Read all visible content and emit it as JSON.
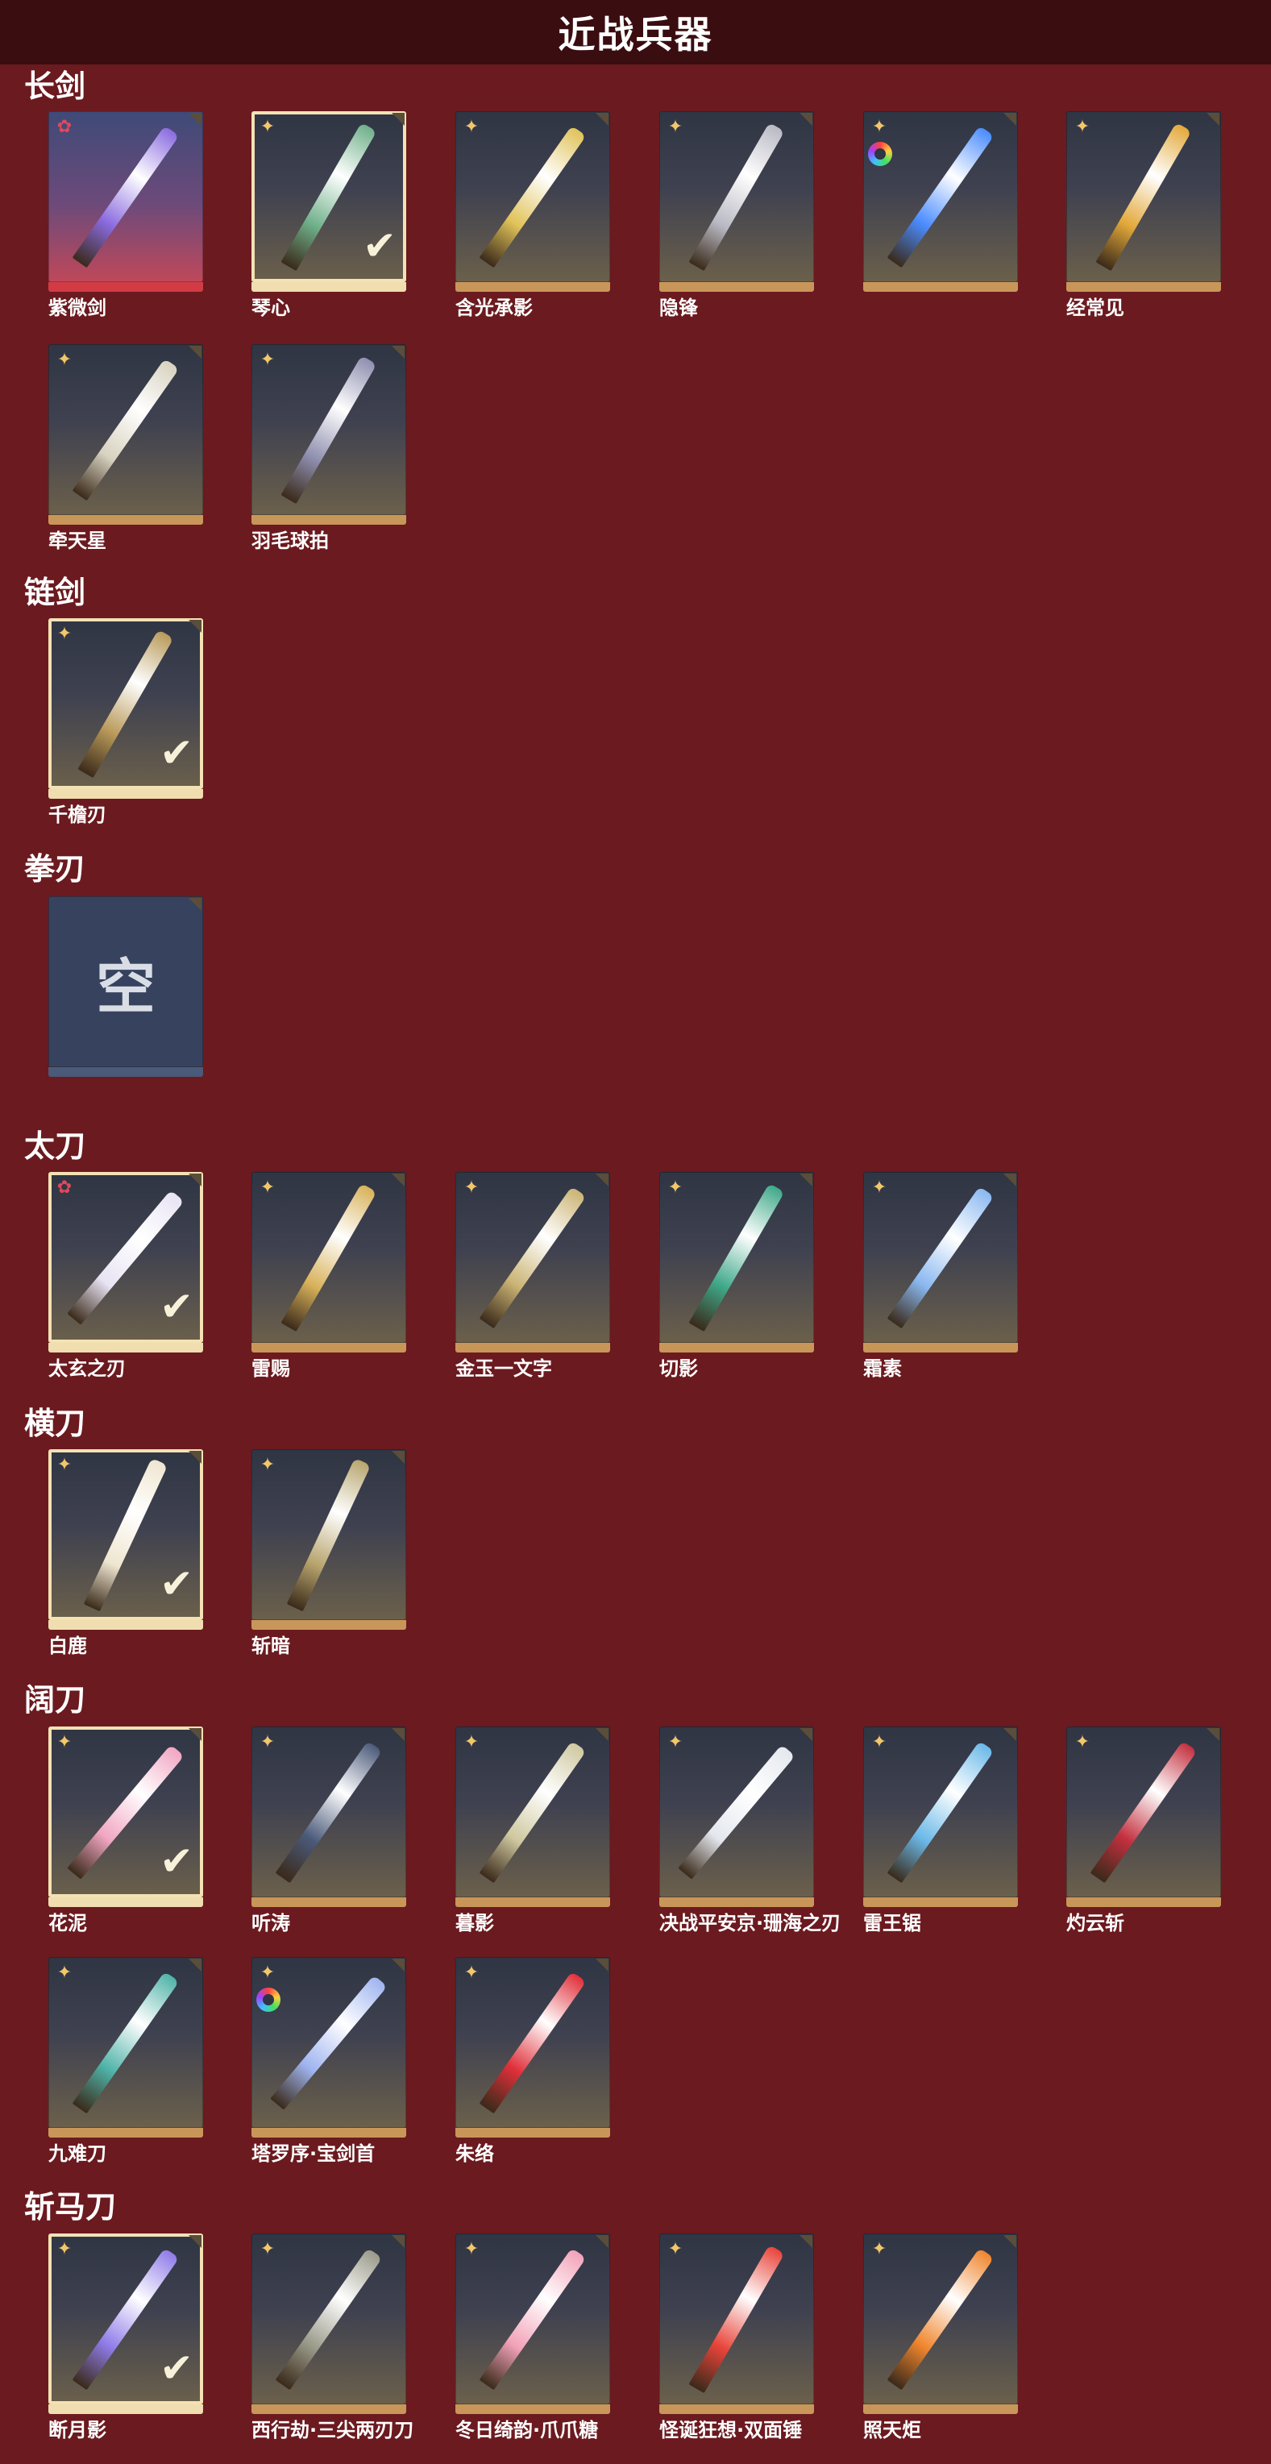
{
  "header": {
    "title": "近战兵器"
  },
  "sections": [
    {
      "id": "long-sword",
      "label": "长剑",
      "items": [
        {
          "name": "紫微剑",
          "rarity": "pink",
          "equipped": false,
          "style": "red",
          "color": "#8a6be0",
          "angle": 35,
          "dyeable": false
        },
        {
          "name": "琴心",
          "rarity": "gold",
          "equipped": true,
          "style": "",
          "color": "#6fb08a",
          "angle": 30,
          "dyeable": false
        },
        {
          "name": "含光承影",
          "rarity": "gold",
          "equipped": false,
          "style": "",
          "color": "#e1c35a",
          "angle": 35,
          "dyeable": false
        },
        {
          "name": "隐锋",
          "rarity": "gold",
          "equipped": false,
          "style": "",
          "color": "#b9b9c4",
          "angle": 30,
          "dyeable": false
        },
        {
          "name": "",
          "rarity": "gold",
          "equipped": false,
          "style": "",
          "color": "#4a8cff",
          "angle": 35,
          "dyeable": true
        },
        {
          "name": "经常见",
          "rarity": "gold",
          "equipped": false,
          "style": "",
          "color": "#e3a93a",
          "angle": 30,
          "dyeable": false
        },
        {
          "name": "牵天星",
          "rarity": "gold",
          "equipped": false,
          "style": "",
          "color": "#d8d2c0",
          "angle": 35,
          "dyeable": false
        },
        {
          "name": "羽毛球拍",
          "rarity": "gold",
          "equipped": false,
          "style": "",
          "color": "#8f8fb0",
          "angle": 30,
          "dyeable": false
        }
      ]
    },
    {
      "id": "chain-sword",
      "label": "链剑",
      "items": [
        {
          "name": "千檐刃",
          "rarity": "gold",
          "equipped": true,
          "style": "",
          "color": "#b99a5a",
          "angle": 30,
          "dyeable": false
        }
      ]
    },
    {
      "id": "fist-blade",
      "label": "拳刃",
      "items": [
        {
          "name": "",
          "rarity": "",
          "equipped": false,
          "style": "empty",
          "color": "",
          "angle": 0,
          "dyeable": false,
          "empty_text": "空"
        }
      ]
    },
    {
      "id": "tachi",
      "label": "太刀",
      "items": [
        {
          "name": "太玄之刃",
          "rarity": "pink",
          "equipped": true,
          "style": "",
          "color": "#e8e4f4",
          "angle": 40,
          "dyeable": false
        },
        {
          "name": "雷赐",
          "rarity": "gold",
          "equipped": false,
          "style": "",
          "color": "#d8b25a",
          "angle": 30,
          "dyeable": false
        },
        {
          "name": "金玉一文字",
          "rarity": "gold",
          "equipped": false,
          "style": "",
          "color": "#cbb474",
          "angle": 35,
          "dyeable": false
        },
        {
          "name": "切影",
          "rarity": "gold",
          "equipped": false,
          "style": "",
          "color": "#3fa889",
          "angle": 30,
          "dyeable": false
        },
        {
          "name": "霜素",
          "rarity": "gold",
          "equipped": false,
          "style": "",
          "color": "#8ab8f0",
          "angle": 35,
          "dyeable": false
        }
      ]
    },
    {
      "id": "horizontal-blade",
      "label": "横刀",
      "items": [
        {
          "name": "白鹿",
          "rarity": "gold",
          "equipped": true,
          "style": "",
          "color": "#efe6d0",
          "angle": 25,
          "dyeable": false
        },
        {
          "name": "斩暗",
          "rarity": "gold",
          "equipped": false,
          "style": "",
          "color": "#b8a56e",
          "angle": 25,
          "dyeable": false
        }
      ]
    },
    {
      "id": "broad-blade",
      "label": "阔刀",
      "items": [
        {
          "name": "花泥",
          "rarity": "gold",
          "equipped": true,
          "style": "",
          "color": "#f1a6c2",
          "angle": 40,
          "dyeable": false
        },
        {
          "name": "听涛",
          "rarity": "gold",
          "equipped": false,
          "style": "",
          "color": "#4b5a7a",
          "angle": 35,
          "dyeable": false
        },
        {
          "name": "暮影",
          "rarity": "gold",
          "equipped": false,
          "style": "",
          "color": "#cfc8a0",
          "angle": 35,
          "dyeable": false
        },
        {
          "name": "决战平安京·珊海之刃",
          "rarity": "gold",
          "equipped": false,
          "style": "",
          "color": "#e4e8ee",
          "angle": 40,
          "dyeable": false
        },
        {
          "name": "雷王锯",
          "rarity": "gold",
          "equipped": false,
          "style": "",
          "color": "#6bb9e8",
          "angle": 35,
          "dyeable": false
        },
        {
          "name": "灼云斩",
          "rarity": "gold",
          "equipped": false,
          "style": "",
          "color": "#c3303f",
          "angle": 35,
          "dyeable": false
        },
        {
          "name": "九难刀",
          "rarity": "gold",
          "equipped": false,
          "style": "",
          "color": "#4fb3a8",
          "angle": 35,
          "dyeable": false
        },
        {
          "name": "塔罗序·宝剑首",
          "rarity": "gold",
          "equipped": false,
          "style": "",
          "color": "#9fb4f0",
          "angle": 40,
          "dyeable": true
        },
        {
          "name": "朱络",
          "rarity": "gold",
          "equipped": false,
          "style": "",
          "color": "#e0303a",
          "angle": 35,
          "dyeable": false
        }
      ]
    },
    {
      "id": "zhanma-blade",
      "label": "斩马刀",
      "items": [
        {
          "name": "断月影",
          "rarity": "gold",
          "equipped": true,
          "style": "",
          "color": "#8f7be8",
          "angle": 35,
          "dyeable": false
        },
        {
          "name": "西行劫·三尖两刃刀",
          "rarity": "gold",
          "equipped": false,
          "style": "",
          "color": "#9a9a8a",
          "angle": 35,
          "dyeable": false
        },
        {
          "name": "冬日绮韵·爪爪糖",
          "rarity": "gold",
          "equipped": false,
          "style": "",
          "color": "#f2a2b8",
          "angle": 35,
          "dyeable": false
        },
        {
          "name": "怪诞狂想·双面锤",
          "rarity": "gold",
          "equipped": false,
          "style": "",
          "color": "#e8443a",
          "angle": 30,
          "dyeable": false
        },
        {
          "name": "照天炬",
          "rarity": "gold",
          "equipped": false,
          "style": "",
          "color": "#f0862e",
          "angle": 35,
          "dyeable": false
        }
      ]
    }
  ],
  "icons": {
    "rarity_gold": "sparkle-icon",
    "rarity_pink": "flower-icon",
    "equipped": "checkmark-icon",
    "dye": "color-wheel-icon"
  }
}
